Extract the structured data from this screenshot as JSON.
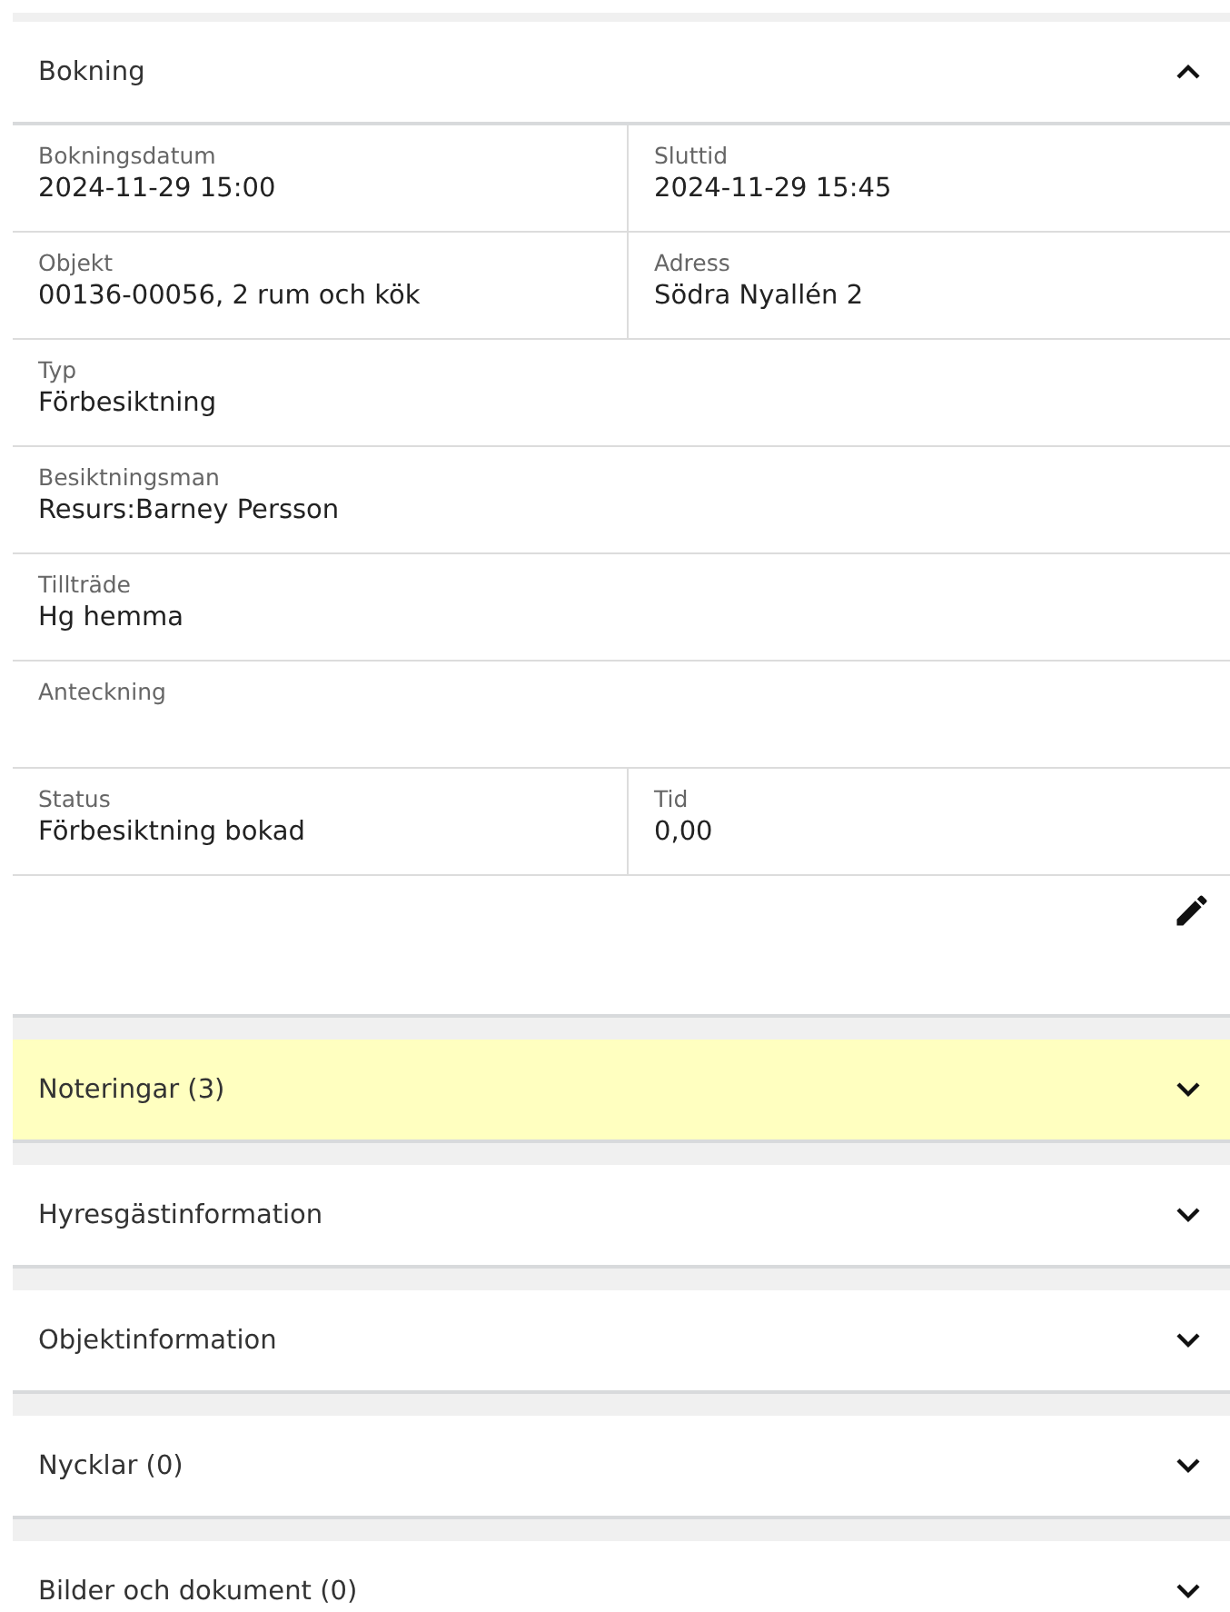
{
  "sections": [
    {
      "title": "Bokning",
      "expanded": true,
      "highlighted": false,
      "rows": [
        [
          {
            "label": "Bokningsdatum",
            "value": "2024-11-29 15:00"
          },
          {
            "label": "Sluttid",
            "value": "2024-11-29 15:45"
          }
        ],
        [
          {
            "label": "Objekt",
            "value": "00136-00056, 2 rum och kök"
          },
          {
            "label": "Adress",
            "value": "Södra Nyallén 2"
          }
        ],
        [
          {
            "label": "Typ",
            "value": "Förbesiktning"
          }
        ],
        [
          {
            "label": "Besiktningsman",
            "value": "Resurs:Barney Persson"
          }
        ],
        [
          {
            "label": "Tillträde",
            "value": "Hg hemma"
          }
        ],
        [
          {
            "label": "Anteckning"
          }
        ],
        [
          {
            "label": "Status",
            "value": "Förbesiktning bokad"
          },
          {
            "label": "Tid",
            "value": "0,00"
          }
        ]
      ]
    },
    {
      "title": "Noteringar (3)",
      "expanded": false,
      "highlighted": true
    },
    {
      "title": "Hyresgästinformation",
      "expanded": false,
      "highlighted": false
    },
    {
      "title": "Objektinformation",
      "expanded": false,
      "highlighted": false
    },
    {
      "title": "Nycklar (0)",
      "expanded": false,
      "highlighted": false
    },
    {
      "title": "Bilder och dokument (0)",
      "expanded": false,
      "highlighted": false
    }
  ]
}
